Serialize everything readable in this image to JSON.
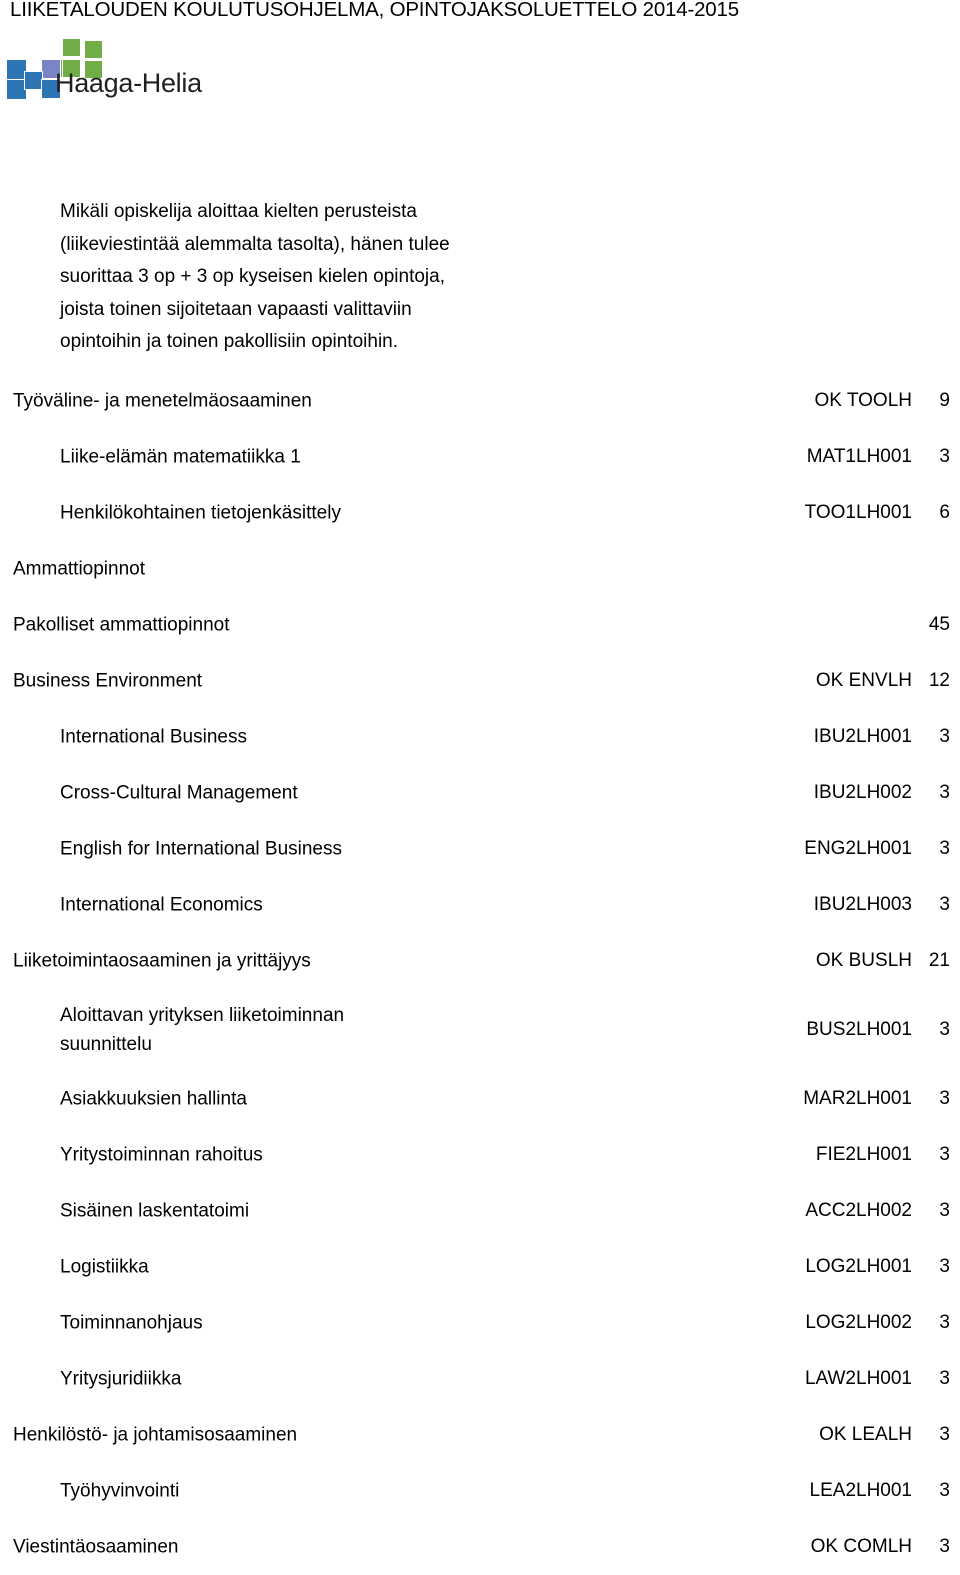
{
  "document": {
    "title": "LIIKETALOUDEN KOULUTUSOHJELMA, OPINTOJAKSOLUETTELO 2014-2015"
  },
  "logo": {
    "wordmark": "Haaga-Helia",
    "colors": {
      "blue": "#2E75B6",
      "green": "#70AD47",
      "purple": "#7B84C4"
    }
  },
  "intro": {
    "lines": [
      "Mikäli opiskelija aloittaa kielten perusteista",
      "(liikeviestintää alemmalta tasolta), hänen tulee",
      "suorittaa 3 op + 3 op kyseisen kielen opintoja,",
      "joista toinen sijoitetaan vapaasti valittaviin",
      "opintoihin ja toinen pakollisiin opintoihin."
    ]
  },
  "table": {
    "rows": [
      {
        "level": 0,
        "name": "Työväline- ja menetelmäosaaminen",
        "code": "OK TOOLH",
        "credits": "9"
      },
      {
        "level": 1,
        "name": "Liike-elämän matematiikka 1",
        "code": "MAT1LH001",
        "credits": "3"
      },
      {
        "level": 1,
        "name": "Henkilökohtainen tietojenkäsittely",
        "code": "TOO1LH001",
        "credits": "6"
      },
      {
        "level": 0,
        "name": "Ammattiopinnot",
        "code": "",
        "credits": ""
      },
      {
        "level": 0,
        "name": "Pakolliset ammattiopinnot",
        "code": "",
        "credits": "45"
      },
      {
        "level": 0,
        "name": "Business Environment",
        "code": "OK ENVLH",
        "credits": "12"
      },
      {
        "level": 1,
        "name": "International Business",
        "code": "IBU2LH001",
        "credits": "3"
      },
      {
        "level": 1,
        "name": "Cross-Cultural Management",
        "code": "IBU2LH002",
        "credits": "3"
      },
      {
        "level": 1,
        "name": "English for International Business",
        "code": "ENG2LH001",
        "credits": "3"
      },
      {
        "level": 1,
        "name": "International Economics",
        "code": "IBU2LH003",
        "credits": "3"
      },
      {
        "level": 0,
        "name": "Liiketoimintaosaaminen ja yrittäjyys",
        "code": "OK BUSLH",
        "credits": "21"
      },
      {
        "level": 1,
        "name": "Aloittavan yrityksen liiketoiminnan\nsuunnittelu",
        "code": "BUS2LH001",
        "credits": "3",
        "tall": true
      },
      {
        "level": 1,
        "name": "Asiakkuuksien hallinta",
        "code": "MAR2LH001",
        "credits": "3"
      },
      {
        "level": 1,
        "name": "Yritystoiminnan rahoitus",
        "code": "FIE2LH001",
        "credits": "3"
      },
      {
        "level": 1,
        "name": "Sisäinen laskentatoimi",
        "code": "ACC2LH002",
        "credits": "3"
      },
      {
        "level": 1,
        "name": "Logistiikka",
        "code": "LOG2LH001",
        "credits": "3"
      },
      {
        "level": 1,
        "name": "Toiminnanohjaus",
        "code": "LOG2LH002",
        "credits": "3"
      },
      {
        "level": 1,
        "name": "Yritysjuridiikka",
        "code": "LAW2LH001",
        "credits": "3"
      },
      {
        "level": 0,
        "name": "Henkilöstö- ja johtamisosaaminen",
        "code": "OK LEALH",
        "credits": "3"
      },
      {
        "level": 1,
        "name": "Työhyvinvointi",
        "code": "LEA2LH001",
        "credits": "3"
      },
      {
        "level": 0,
        "name": "Viestintäosaaminen",
        "code": "OK COMLH",
        "credits": "3"
      }
    ]
  }
}
